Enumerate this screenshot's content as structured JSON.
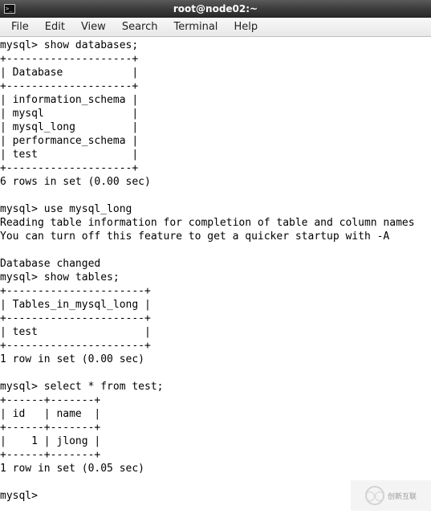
{
  "window": {
    "title": "root@node02:~"
  },
  "menu": {
    "file": "File",
    "edit": "Edit",
    "view": "View",
    "search": "Search",
    "terminal": "Terminal",
    "help": "Help"
  },
  "terminal_output": "mysql> show databases;\n+--------------------+\n| Database           |\n+--------------------+\n| information_schema |\n| mysql              |\n| mysql_long         |\n| performance_schema |\n| test               |\n+--------------------+\n6 rows in set (0.00 sec)\n\nmysql> use mysql_long\nReading table information for completion of table and column names\nYou can turn off this feature to get a quicker startup with -A\n\nDatabase changed\nmysql> show tables;\n+----------------------+\n| Tables_in_mysql_long |\n+----------------------+\n| test                 |\n+----------------------+\n1 row in set (0.00 sec)\n\nmysql> select * from test;\n+------+-------+\n| id   | name  |\n+------+-------+\n|    1 | jlong |\n+------+-------+\n1 row in set (0.05 sec)\n\nmysql> ",
  "watermark": {
    "text": "创新互联"
  }
}
